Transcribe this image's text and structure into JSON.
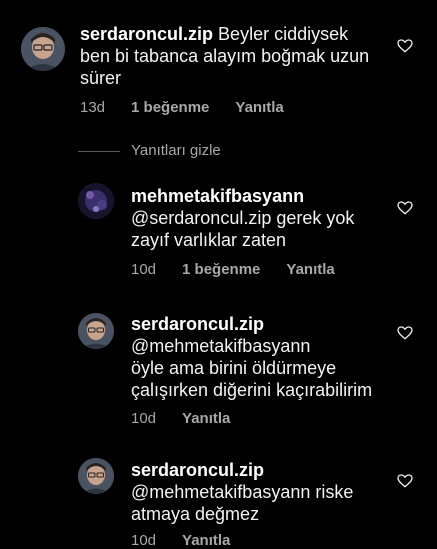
{
  "comments": [
    {
      "username": "serdaroncul.zip",
      "text_lines": [
        "Beyler ciddiysek",
        "ben bi tabanca alayım boğmak uzun",
        "sürer"
      ],
      "time": "13d",
      "likes": "1 beğenme",
      "reply": "Yanıtla"
    },
    {
      "username": "mehmetakifbasyann",
      "text_lines": [
        "@serdaroncul.zip gerek yok",
        "zayıf varlıklar zaten"
      ],
      "time": "10d",
      "likes": "1 beğenme",
      "reply": "Yanıtla"
    },
    {
      "username": "serdaroncul.zip",
      "text_lines": [
        "@mehmetakifbasyann",
        "öyle ama birini öldürmeye",
        "çalışırken diğerini kaçırabilirim"
      ],
      "time": "10d",
      "reply": "Yanıtla"
    },
    {
      "username": "serdaroncul.zip",
      "text_lines": [
        "@mehmetakifbasyann riske",
        "atmaya değmez"
      ],
      "time": "10d",
      "reply": "Yanıtla"
    }
  ],
  "hide_replies": "Yanıtları gizle",
  "icons": {
    "like": "heart-outline-icon"
  },
  "colors": {
    "background": "#000000",
    "meta_text": "#a8a8a8",
    "body_text": "#f2f2f2"
  }
}
